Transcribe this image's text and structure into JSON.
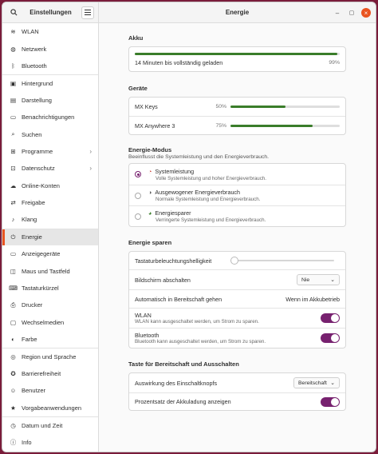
{
  "sidebar": {
    "title": "Einstellungen",
    "items": [
      {
        "label": "WLAN",
        "icon": "wifi-icon",
        "glyph": "≋"
      },
      {
        "label": "Netzwerk",
        "icon": "network-icon",
        "glyph": "◍"
      },
      {
        "label": "Bluetooth",
        "icon": "bluetooth-icon",
        "glyph": "ᛒ"
      },
      {
        "label": "Hintergrund",
        "icon": "background-icon",
        "glyph": "▣"
      },
      {
        "label": "Darstellung",
        "icon": "appearance-icon",
        "glyph": "▤"
      },
      {
        "label": "Benachrichtigungen",
        "icon": "notifications-icon",
        "glyph": "▭"
      },
      {
        "label": "Suchen",
        "icon": "search-icon",
        "glyph": "⌕"
      },
      {
        "label": "Programme",
        "icon": "apps-icon",
        "glyph": "⊞",
        "chevron": true
      },
      {
        "label": "Datenschutz",
        "icon": "privacy-icon",
        "glyph": "⊡",
        "chevron": true
      },
      {
        "label": "Online-Konten",
        "icon": "online-accounts-icon",
        "glyph": "☁"
      },
      {
        "label": "Freigabe",
        "icon": "sharing-icon",
        "glyph": "⇄"
      },
      {
        "label": "Klang",
        "icon": "sound-icon",
        "glyph": "♪"
      },
      {
        "label": "Energie",
        "icon": "power-icon",
        "glyph": "⏻",
        "active": true
      },
      {
        "label": "Anzeigegeräte",
        "icon": "displays-icon",
        "glyph": "▭"
      },
      {
        "label": "Maus und Tastfeld",
        "icon": "mouse-icon",
        "glyph": "◫"
      },
      {
        "label": "Tastaturkürzel",
        "icon": "keyboard-icon",
        "glyph": "⌨"
      },
      {
        "label": "Drucker",
        "icon": "printer-icon",
        "glyph": "⎙"
      },
      {
        "label": "Wechselmedien",
        "icon": "removable-media-icon",
        "glyph": "▢"
      },
      {
        "label": "Farbe",
        "icon": "color-icon",
        "glyph": "◐"
      },
      {
        "label": "Region und Sprache",
        "icon": "region-icon",
        "glyph": "◎"
      },
      {
        "label": "Barrierefreiheit",
        "icon": "accessibility-icon",
        "glyph": "✪"
      },
      {
        "label": "Benutzer",
        "icon": "users-icon",
        "glyph": "☺"
      },
      {
        "label": "Vorgabeanwendungen",
        "icon": "default-apps-icon",
        "glyph": "★"
      },
      {
        "label": "Datum und Zeit",
        "icon": "datetime-icon",
        "glyph": "◷"
      },
      {
        "label": "Info",
        "icon": "info-icon",
        "glyph": "ⓘ"
      }
    ]
  },
  "window": {
    "title": "Energie"
  },
  "battery": {
    "heading": "Akku",
    "status": "14 Minuten bis vollständig geladen",
    "percent_label": "99%",
    "level": 0.99
  },
  "devices": {
    "heading": "Geräte",
    "items": [
      {
        "name": "MX Keys",
        "percent_label": "50%",
        "level": 0.5
      },
      {
        "name": "MX Anywhere 3",
        "percent_label": "75%",
        "level": 0.75
      }
    ]
  },
  "power_mode": {
    "heading": "Energie-Modus",
    "subtitle": "Beeinflusst die Systemleistung und den Energieverbrauch.",
    "options": [
      {
        "label": "Systemleistung",
        "desc": "Volle Systemleistung und hoher Energieverbrauch.",
        "selected": true
      },
      {
        "label": "Ausgewogener Energieverbrauch",
        "desc": "Normale Systemleistung und Energieverbrauch.",
        "selected": false
      },
      {
        "label": "Energiesparer",
        "desc": "Verringerte Systemleistung und Energieverbrauch.",
        "selected": false
      }
    ]
  },
  "saving": {
    "heading": "Energie sparen",
    "kbd_backlight": "Tastaturbeleuchtungshelligkeit",
    "kbd_level": 0,
    "blank_screen": "Bildschirm abschalten",
    "blank_value": "Nie",
    "auto_suspend": "Automatisch in Bereitschaft gehen",
    "auto_suspend_value": "Wenn im Akkubetrieb",
    "wlan": "WLAN",
    "wlan_desc": "WLAN kann ausgeschaltet werden, um Strom zu sparen.",
    "bluetooth": "Bluetooth",
    "bluetooth_desc": "Bluetooth kann ausgeschaltet werden, um Strom zu sparen."
  },
  "suspend": {
    "heading": "Taste für Bereitschaft und Ausschalten",
    "power_button": "Auswirkung des Einschaltknopfs",
    "power_button_value": "Bereitschaft",
    "show_percent": "Prozentsatz der Akkuladung anzeigen"
  },
  "colors": {
    "accent": "#77216f",
    "bar": "#3a7d2a",
    "active_marker": "#e95420"
  }
}
